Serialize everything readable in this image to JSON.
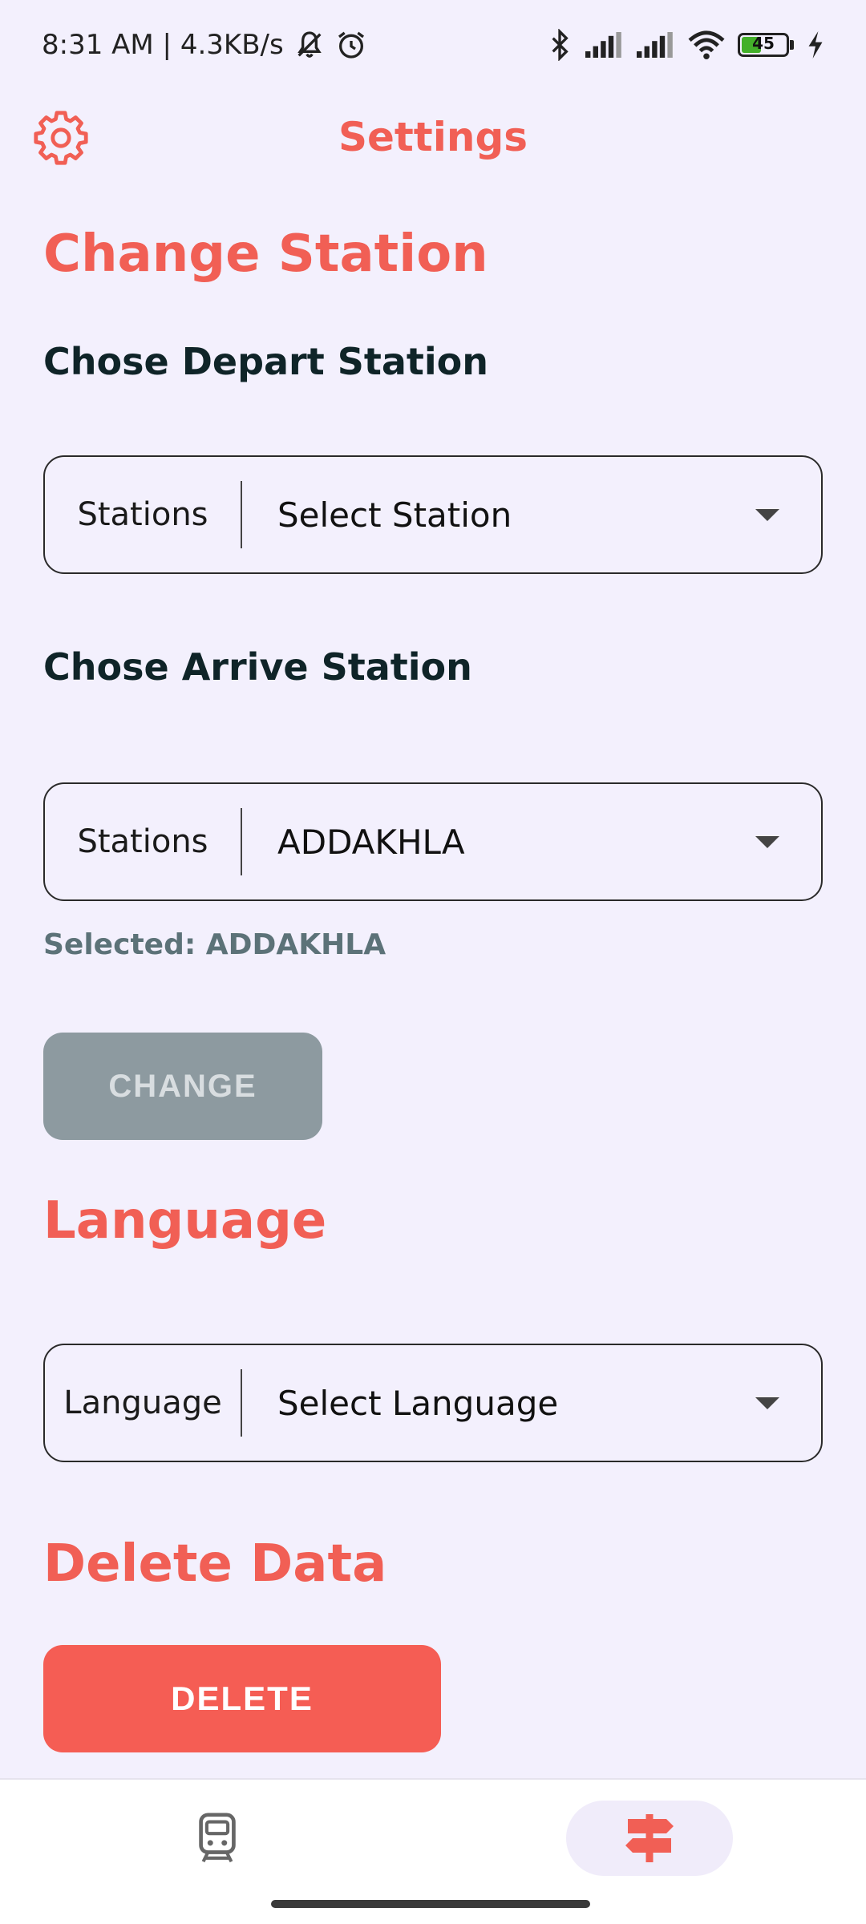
{
  "status_bar": {
    "time_info": "8:31 AM | 4.3KB/s",
    "battery_level": "45",
    "icons": [
      "muted-notification-icon",
      "alarm-icon",
      "bluetooth-icon",
      "signal-icon",
      "signal-icon",
      "wifi-icon",
      "battery-icon",
      "charging-icon"
    ]
  },
  "app_bar": {
    "title": "Settings",
    "icon": "gear-icon"
  },
  "change_station": {
    "title": "Change Station",
    "depart": {
      "label": "Chose Depart Station",
      "prefix": "Stations",
      "value": "Select Station"
    },
    "arrive": {
      "label": "Chose Arrive Station",
      "prefix": "Stations",
      "value": "ADDAKHLA"
    },
    "selected_text": "Selected: ADDAKHLA",
    "change_button": "CHANGE"
  },
  "language": {
    "title": "Language",
    "prefix": "Language",
    "value": "Select Language"
  },
  "delete_data": {
    "title": "Delete Data",
    "button": "DELETE"
  },
  "bottom_nav": {
    "items": [
      {
        "icon": "train-icon",
        "active": false
      },
      {
        "icon": "signpost-icon",
        "active": true
      }
    ]
  },
  "colors": {
    "accent": "#f15f55",
    "background": "#f3f0fd",
    "disabled_button": "#8d9aa0",
    "delete_button": "#f55d54"
  }
}
